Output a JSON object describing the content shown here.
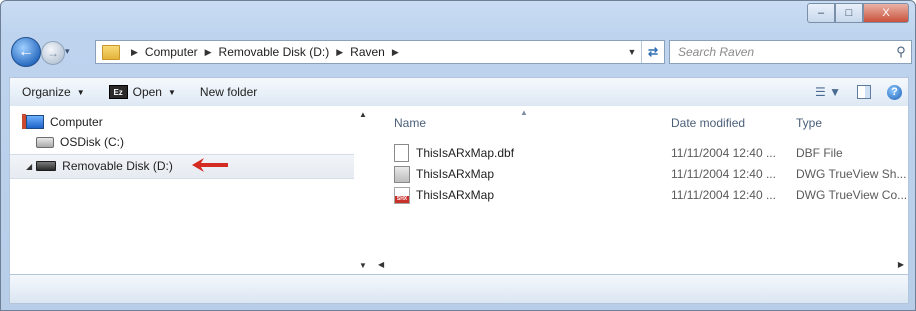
{
  "window": {
    "controls": {
      "minimize": "–",
      "maximize": "□",
      "close": "X"
    }
  },
  "nav": {
    "back_icon": "back-arrow-icon",
    "forward_icon": "forward-arrow-icon",
    "dropdown": "▾",
    "breadcrumbs": [
      "Computer",
      "Removable Disk (D:)",
      "Raven"
    ],
    "search_placeholder": "Search Raven"
  },
  "toolbar": {
    "organize": "Organize",
    "open_icon_text": "Ez",
    "open": "Open",
    "new_folder": "New folder"
  },
  "tree": {
    "computer": "Computer",
    "osdisk": "OSDisk (C:)",
    "removable": "Removable Disk (D:)"
  },
  "files": {
    "columns": {
      "name": "Name",
      "date": "Date modified",
      "type": "Type"
    },
    "rows": [
      {
        "name": "ThisIsARxMap.dbf",
        "date": "11/11/2004 12:40 ...",
        "type": "DBF File",
        "icon": "document-icon"
      },
      {
        "name": "ThisIsARxMap",
        "date": "11/11/2004 12:40 ...",
        "type": "DWG TrueView Sh...",
        "icon": "dwg-file-icon"
      },
      {
        "name": "ThisIsARxMap",
        "date": "11/11/2004 12:40 ...",
        "type": "DWG TrueView Co...",
        "icon": "shx-file-icon"
      }
    ]
  },
  "colors": {
    "annotation_arrow": "#d42b22"
  }
}
